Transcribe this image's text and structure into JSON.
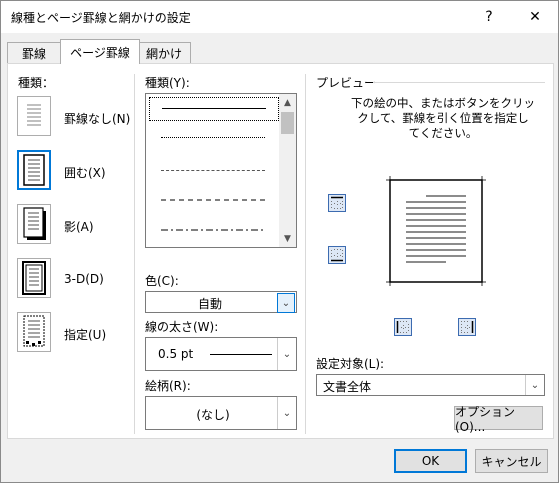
{
  "window": {
    "title": "線種とページ罫線と網かけの設定",
    "help": "?",
    "close": "✕"
  },
  "tabs": [
    "罫線",
    "ページ罫線",
    "網かけ"
  ],
  "setting": {
    "label": "種類：",
    "items": [
      {
        "label": "罫線なし(N)",
        "icon": "no-border-icon"
      },
      {
        "label": "囲む(X)",
        "icon": "box-border-icon",
        "selected": true
      },
      {
        "label": "影(A)",
        "icon": "shadow-border-icon"
      },
      {
        "label": "3-D(D)",
        "icon": "3d-border-icon"
      },
      {
        "label": "指定(U)",
        "icon": "custom-border-icon"
      }
    ]
  },
  "style": {
    "label": "種類(Y):",
    "line_styles": [
      "solid",
      "dotted",
      "fine-dashed",
      "dashed",
      "dash-dot"
    ]
  },
  "color": {
    "label": "色(C):",
    "value": "自動"
  },
  "width": {
    "label": "線の太さ(W):",
    "value": "0.5 pt"
  },
  "art": {
    "label": "絵柄(R):",
    "value": "(なし)"
  },
  "preview": {
    "label": "プレビュー",
    "instructions": [
      "下の絵の中、またはボタンをクリッ",
      "クして、罫線を引く位置を指定し",
      "てください。"
    ]
  },
  "apply_to": {
    "label": "設定対象(L):",
    "value": "文書全体"
  },
  "buttons": {
    "options": "オプション(O)...",
    "ok": "OK",
    "cancel": "キャンセル"
  },
  "colors": {
    "accent": "#0078d7",
    "panel": "#ffffff",
    "dialog": "#f0f0f0"
  }
}
